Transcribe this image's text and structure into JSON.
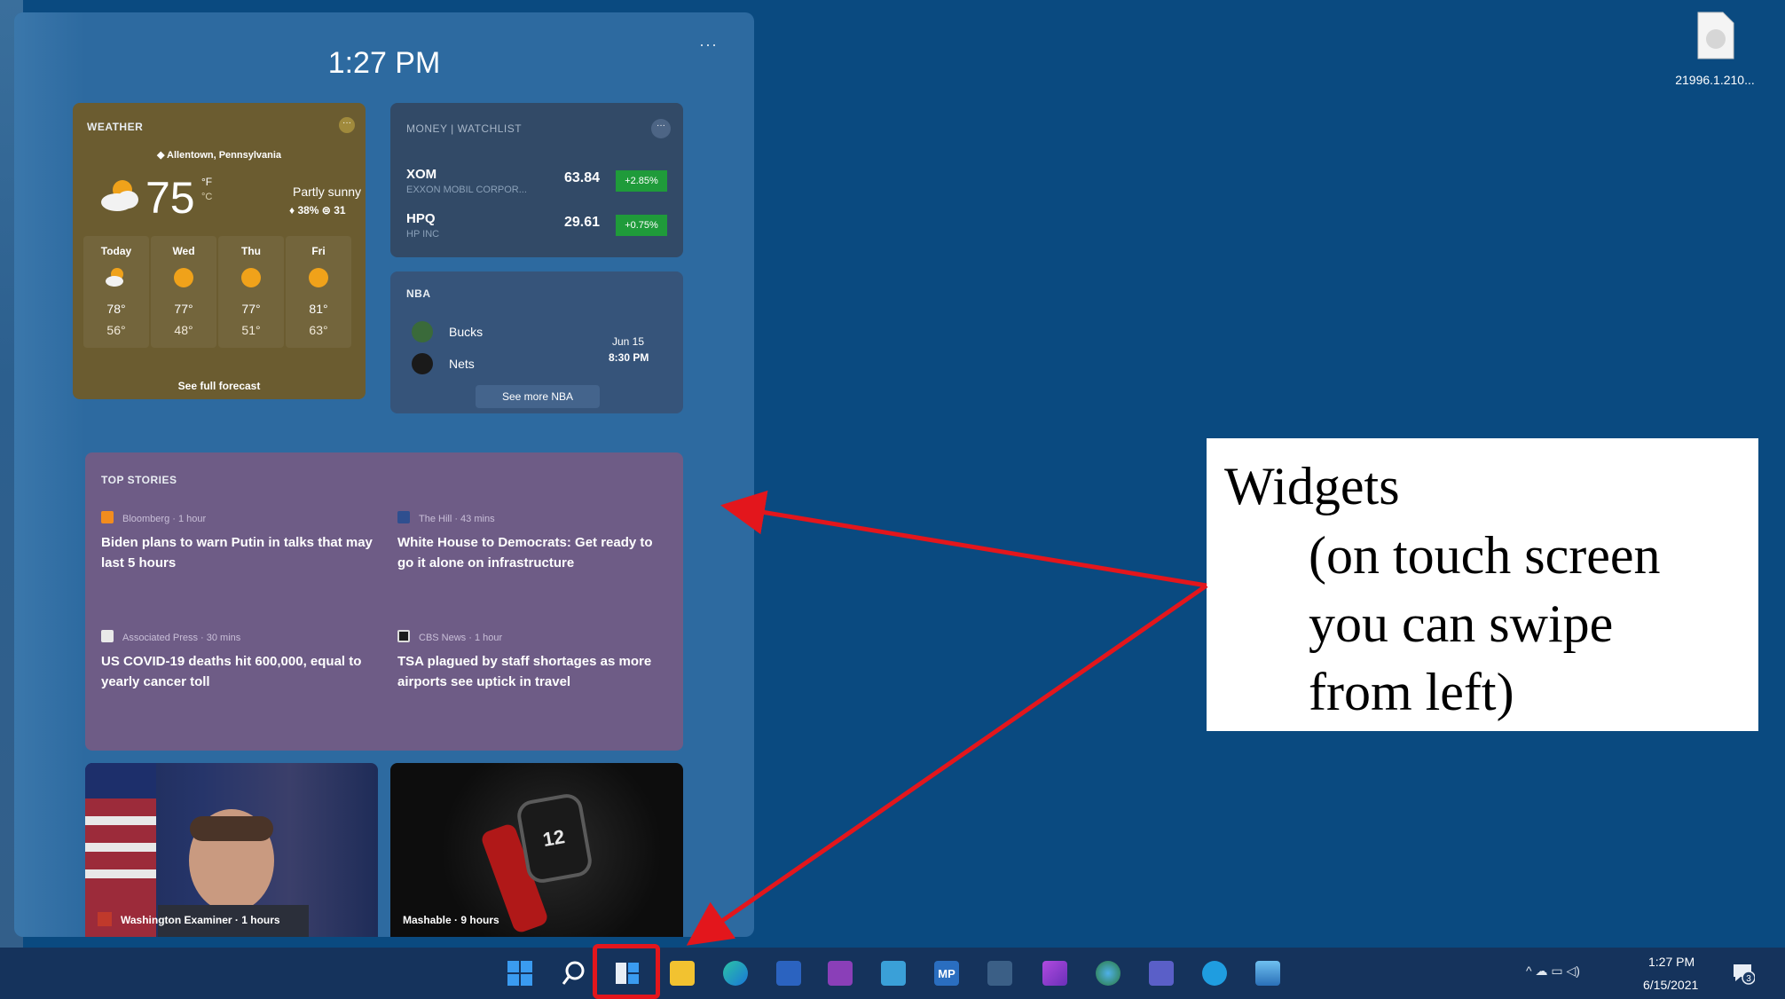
{
  "panel": {
    "time": "1:27 PM",
    "more": "···"
  },
  "weather": {
    "caption": "WEATHER",
    "more": "···",
    "location": "◆ Allentown, Pennsylvania",
    "temp": "75",
    "unit_f": "°F",
    "unit_c": "°C",
    "description": "Partly sunny",
    "precip": "♦ 38%   ⊜ 31",
    "forecast": [
      {
        "day": "Today",
        "hi": "78°",
        "lo": "56°",
        "icon": "partly-cloudy-icon"
      },
      {
        "day": "Wed",
        "hi": "77°",
        "lo": "48°",
        "icon": "sun-icon"
      },
      {
        "day": "Thu",
        "hi": "77°",
        "lo": "51°",
        "icon": "sun-icon"
      },
      {
        "day": "Fri",
        "hi": "81°",
        "lo": "63°",
        "icon": "sun-icon"
      }
    ],
    "link": "See full forecast"
  },
  "money": {
    "caption": "MONEY | WATCHLIST",
    "more": "···",
    "stocks": [
      {
        "ticker": "XOM",
        "name": "EXXON MOBIL CORPOR...",
        "price": "63.84",
        "change": "+2.85%"
      },
      {
        "ticker": "HPQ",
        "name": "HP INC",
        "price": "29.61",
        "change": "+0.75%"
      }
    ],
    "change_color": "#1f9b3a"
  },
  "nba": {
    "caption": "NBA",
    "teams": [
      {
        "name": "Bucks"
      },
      {
        "name": "Nets"
      }
    ],
    "date": "Jun 15",
    "time": "8:30 PM",
    "link": "See more NBA"
  },
  "stories": {
    "caption": "TOP STORIES",
    "items": [
      {
        "source": "Bloomberg · 1 hour",
        "headline": "Biden plans to warn Putin in talks that may last 5 hours"
      },
      {
        "source": "The Hill · 43 mins",
        "headline": "White House to Democrats: Get ready to go it alone on infrastructure"
      },
      {
        "source": "Associated Press · 30 mins",
        "headline": "US COVID-19 deaths hit 600,000, equal to yearly cancer toll"
      },
      {
        "source": "CBS News · 1 hour",
        "headline": "TSA plagued by staff shortages as more airports see uptick in travel"
      }
    ]
  },
  "image_cards": [
    {
      "caption": "Washington Examiner · 1 hours"
    },
    {
      "caption": "Mashable · 9 hours"
    }
  ],
  "desktop": {
    "file_label": "21996.1.210..."
  },
  "callout": {
    "line1": "Widgets",
    "line2": "(on touch screen",
    "line3": "you can swipe",
    "line4": "from left)"
  },
  "taskbar": {
    "apps": [
      "start-icon",
      "search-icon",
      "widgets-icon",
      "file-explorer-icon",
      "edge-icon",
      "word-icon",
      "onenote-icon",
      "notepad-icon",
      "mp-icon",
      "mixer-icon",
      "affinity-icon",
      "maps-icon",
      "teams-icon",
      "skype-icon",
      "photos-icon"
    ],
    "mp_label": "MP",
    "tray_text": "^  ☁  ▭  ◁)",
    "clock_time": "1:27 PM",
    "clock_date": "6/15/2021",
    "notification_count": "3"
  },
  "colors": {
    "desktop": "#0a4a80",
    "panel": "#2d6aa0",
    "arrow": "#e3161c"
  }
}
